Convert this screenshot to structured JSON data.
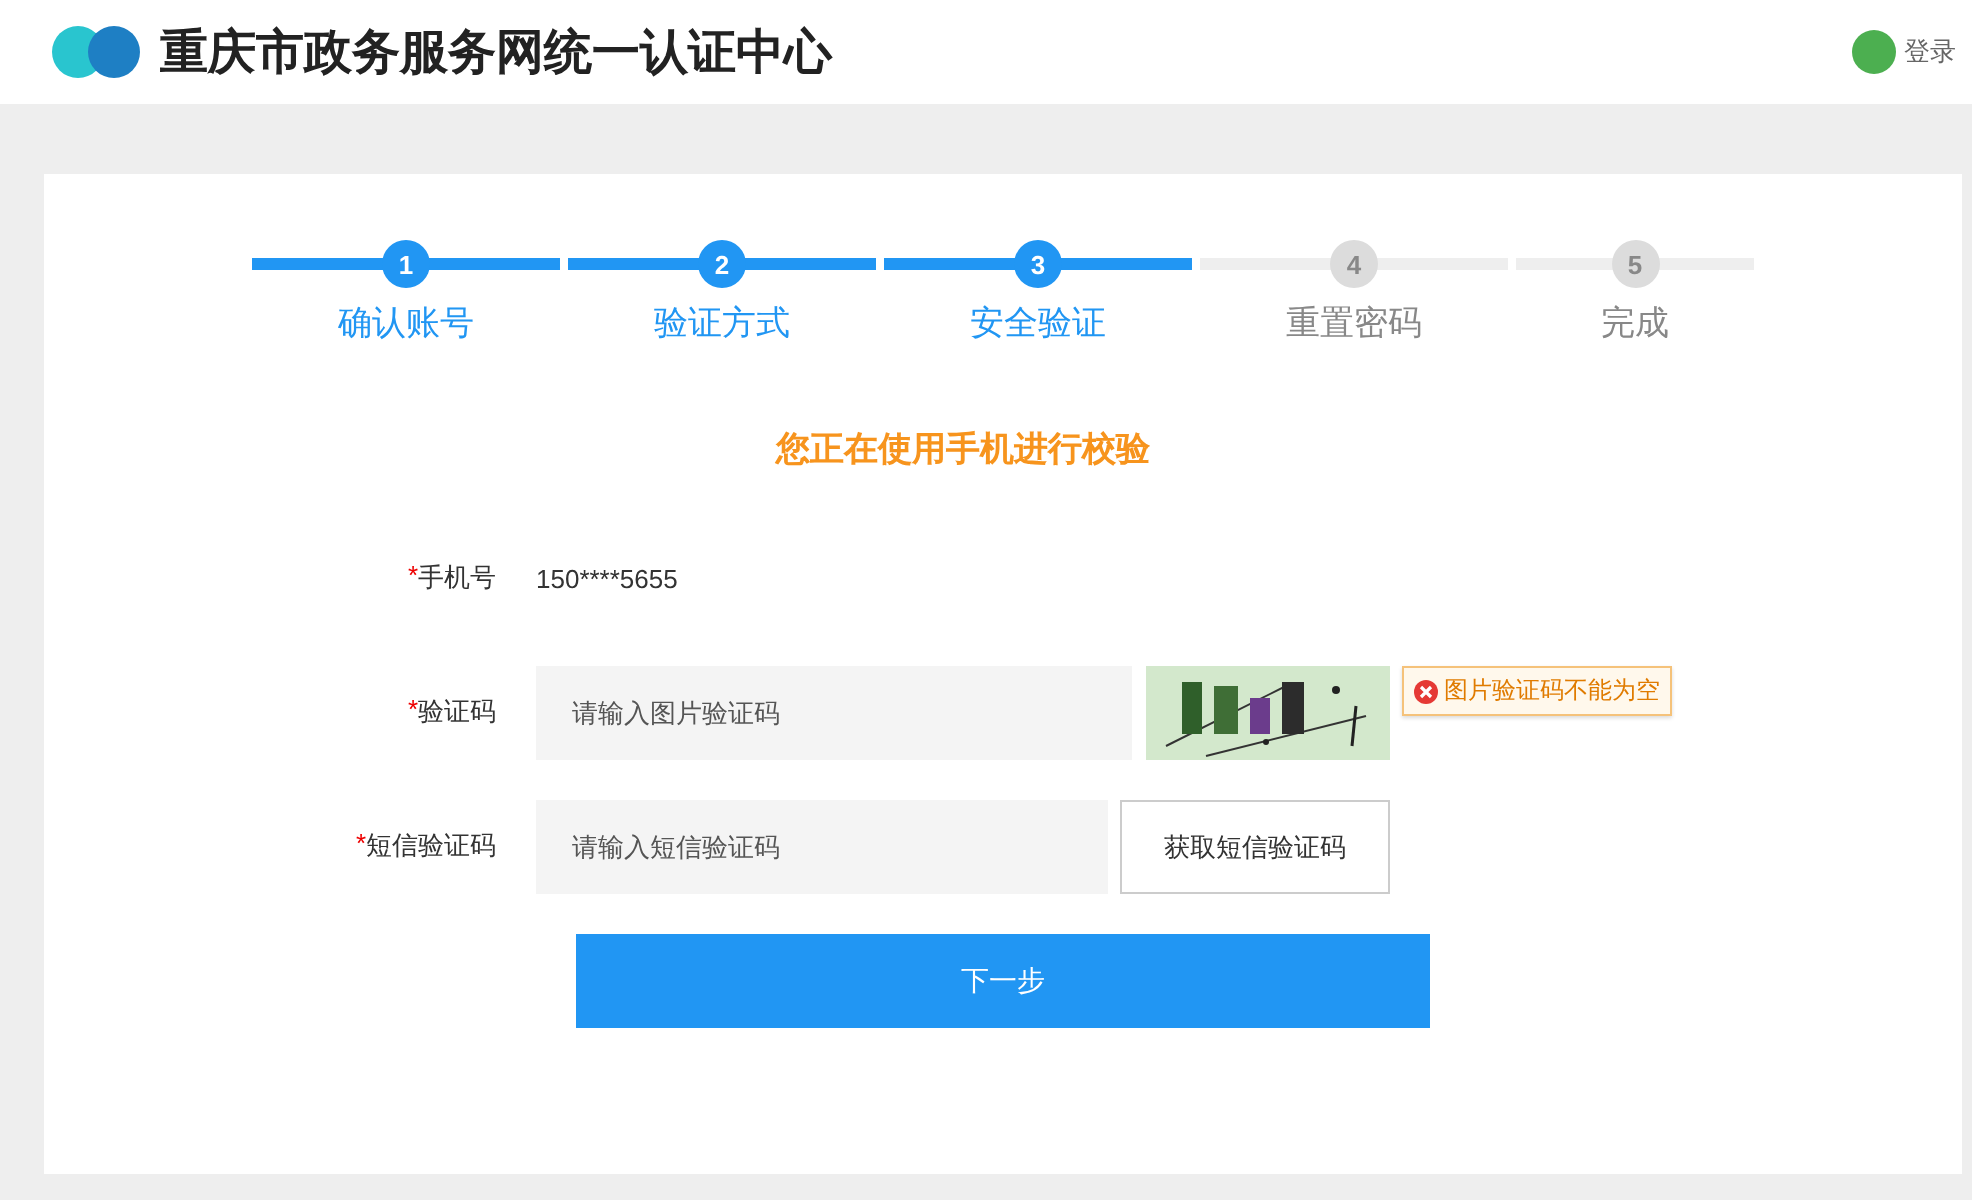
{
  "header": {
    "title": "重庆市政务服务网统一认证中心",
    "login": "登录"
  },
  "steps": [
    {
      "number": "1",
      "label": "确认账号",
      "completed": true
    },
    {
      "number": "2",
      "label": "验证方式",
      "completed": true
    },
    {
      "number": "3",
      "label": "安全验证",
      "completed": true
    },
    {
      "number": "4",
      "label": "重置密码",
      "completed": false
    },
    {
      "number": "5",
      "label": "完成",
      "completed": false
    }
  ],
  "heading": "您正在使用手机进行校验",
  "fields": [
    {
      "kind": "text",
      "required_mark": "*",
      "label": "手机号",
      "value": "150****5655"
    },
    {
      "kind": "captcha",
      "required_mark": "*",
      "label": "验证码",
      "placeholder": "请输入图片验证码",
      "error": "图片验证码不能为空"
    },
    {
      "kind": "sms",
      "required_mark": "*",
      "label": "短信验证码",
      "placeholder": "请输入短信验证码",
      "button": "获取短信验证码"
    }
  ],
  "submit": "下一步"
}
